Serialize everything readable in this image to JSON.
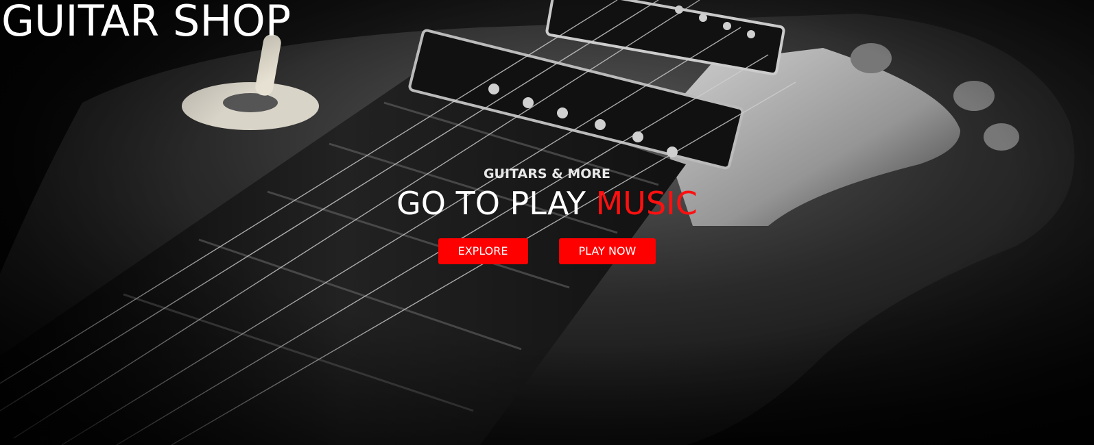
{
  "brand": {
    "title": "GUITAR SHOP"
  },
  "hero": {
    "subtitle": "GUITARS & MORE",
    "headline_main": "GO TO PLAY ",
    "headline_accent": "MUSIC",
    "background_image": "black-and-white electric guitar close-up"
  },
  "actions": {
    "explore_label": "EXPLORE",
    "play_now_label": "PLAY NOW"
  },
  "colors": {
    "accent": "#ff0000",
    "text": "#ffffff",
    "background": "#000000"
  }
}
